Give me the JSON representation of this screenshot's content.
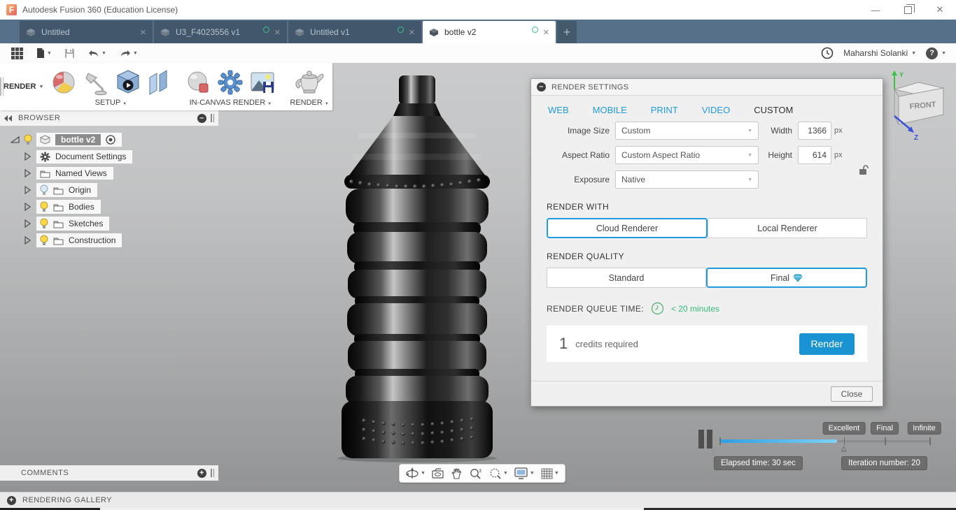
{
  "window": {
    "title": "Autodesk Fusion 360 (Education License)"
  },
  "tabs": [
    {
      "label": "Untitled"
    },
    {
      "label": "U3_F4023556 v1"
    },
    {
      "label": "Untitled v1"
    },
    {
      "label": "bottle v2"
    }
  ],
  "account": {
    "user_name": "Maharshi Solanki"
  },
  "ribbon": {
    "workspace_label": "RENDER",
    "setup_label": "SETUP",
    "in_canvas_label": "IN-CANVAS RENDER",
    "render_label": "RENDER"
  },
  "browser": {
    "title": "BROWSER",
    "root": "bottle v2",
    "items": [
      "Document Settings",
      "Named Views",
      "Origin",
      "Bodies",
      "Sketches",
      "Construction"
    ]
  },
  "dialog": {
    "title": "RENDER SETTINGS",
    "tabs": [
      "WEB",
      "MOBILE",
      "PRINT",
      "VIDEO",
      "CUSTOM"
    ],
    "active_tab": "CUSTOM",
    "fields": {
      "image_size_label": "Image Size",
      "image_size_value": "Custom",
      "aspect_ratio_label": "Aspect Ratio",
      "aspect_ratio_value": "Custom Aspect Ratio",
      "exposure_label": "Exposure",
      "exposure_value": "Native",
      "width_label": "Width",
      "width_value": "1366",
      "height_label": "Height",
      "height_value": "614",
      "px_unit": "px"
    },
    "render_with": {
      "label": "RENDER WITH",
      "option_cloud": "Cloud Renderer",
      "option_local": "Local Renderer",
      "selected": "Cloud Renderer"
    },
    "render_quality": {
      "label": "RENDER QUALITY",
      "option_standard": "Standard",
      "option_final": "Final",
      "selected": "Final"
    },
    "queue": {
      "label": "RENDER QUEUE TIME:",
      "value": "< 20 minutes"
    },
    "credits": {
      "count": "1",
      "text": "credits required"
    },
    "render_button": "Render",
    "close_button": "Close"
  },
  "progress": {
    "labels": [
      "Excellent",
      "Final",
      "Infinite"
    ],
    "elapsed": "Elapsed time: 30 sec",
    "iteration": "Iteration number: 20",
    "fill_percent": 56
  },
  "comments": {
    "title": "COMMENTS"
  },
  "gallery": {
    "title": "RENDERING GALLERY"
  },
  "viewcube": {
    "front_label": "FRONT",
    "y_axis": "Y",
    "z_axis": "Z"
  },
  "colors": {
    "accent_blue": "#1f9ade",
    "queue_green": "#35b878",
    "tabbar": "#56708a",
    "render_button": "#1993d2"
  }
}
